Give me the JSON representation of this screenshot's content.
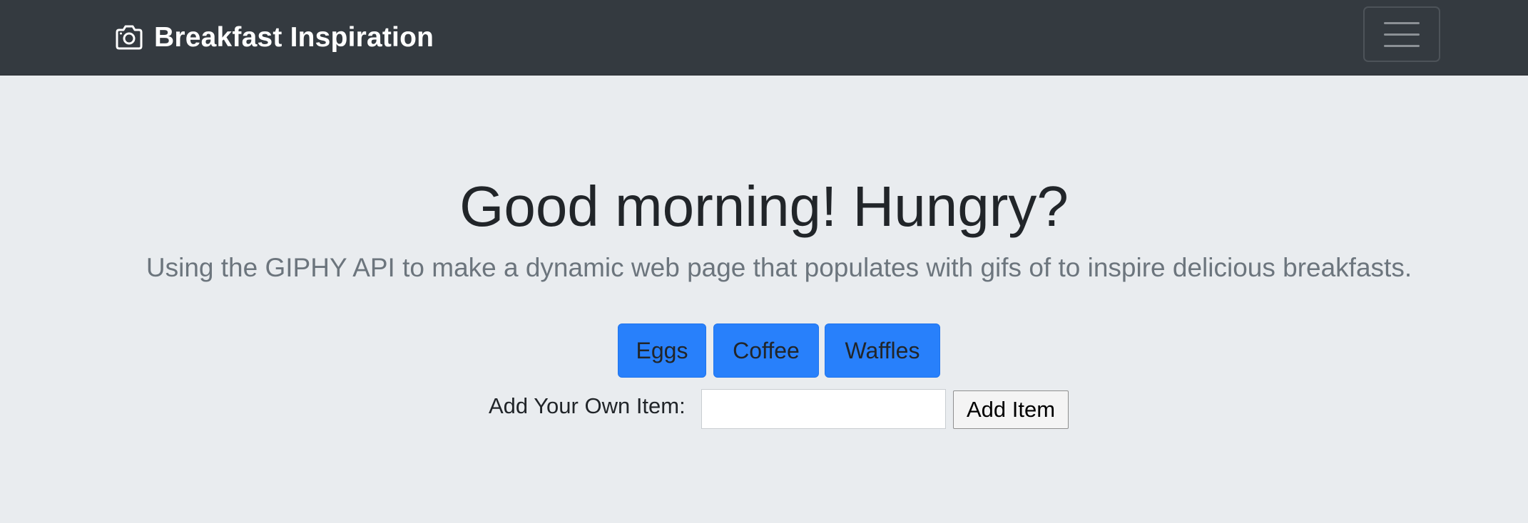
{
  "navbar": {
    "brand_icon": "camera-icon",
    "brand_text": "Breakfast Inspiration",
    "toggler_icon": "hamburger-menu-icon",
    "background_color": "#343a40"
  },
  "hero": {
    "title": "Good morning! Hungry?",
    "lead": "Using the GIPHY API to make a dynamic web page that populates with gifs of to inspire delicious breakfasts."
  },
  "food_buttons": [
    {
      "label": "Eggs"
    },
    {
      "label": "Coffee"
    },
    {
      "label": "Waffles"
    }
  ],
  "add_form": {
    "label": "Add Your Own Item:",
    "input_value": "",
    "button_label": "Add Item"
  },
  "colors": {
    "primary_button": "#2880fb",
    "page_background": "#e9ecef",
    "lead_text": "#6c757d"
  }
}
